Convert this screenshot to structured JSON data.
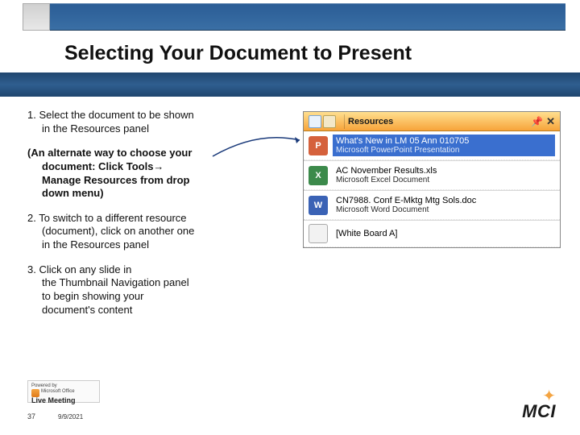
{
  "slide": {
    "title": "Selecting Your Document to Present",
    "step1_prefix": "1. ",
    "step1_line1": "Select the document to be shown",
    "step1_line2": "in the Resources panel",
    "alt_prefix": "(An alternate way to choose your",
    "alt_l2": "document:  Click Tools→",
    "alt_l3": "Manage Resources from drop",
    "alt_l4": "down menu)",
    "step2_prefix": "2. ",
    "step2_l1": "To switch to a different resource",
    "step2_l2": "(document), click on another one",
    "step2_l3": "in the Resources panel",
    "step3_prefix": "3.  ",
    "step3_l1": "Click on any slide in",
    "step3_l2": "the Thumbnail Navigation panel",
    "step3_l3": "to begin showing your",
    "step3_l4": "document's content"
  },
  "panel": {
    "title": "Resources",
    "items": [
      {
        "name": "What's New in LM 05 Ann 010705",
        "type": "Microsoft PowerPoint Presentation",
        "icon": "P"
      },
      {
        "name": "AC   November Results.xls",
        "type": "Microsoft Excel Document",
        "icon": "X"
      },
      {
        "name": "CN7988. Conf E-Mktg Mtg Sols.doc",
        "type": "Microsoft Word Document",
        "icon": "W"
      },
      {
        "name": "[White Board A]",
        "type": "",
        "icon": ""
      }
    ]
  },
  "footer": {
    "badge_top": "Powered by",
    "badge_mid": "Microsoft Office",
    "badge_name": "Live Meeting",
    "page": "37",
    "date": "9/9/2021",
    "logo": "MCI"
  }
}
